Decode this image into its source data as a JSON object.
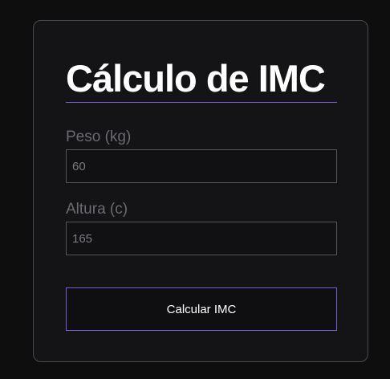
{
  "form": {
    "title": "Cálculo de IMC",
    "fields": [
      {
        "label": "Peso (kg)",
        "value": "60"
      },
      {
        "label": "Altura (c)",
        "value": "165"
      }
    ],
    "submit_label": "Calcular IMC",
    "colors": {
      "background": "#0e0e0f",
      "card": "#141416",
      "accent": "#7b5cd6",
      "text": "#ffffff",
      "muted_label": "#6a6a70"
    }
  }
}
